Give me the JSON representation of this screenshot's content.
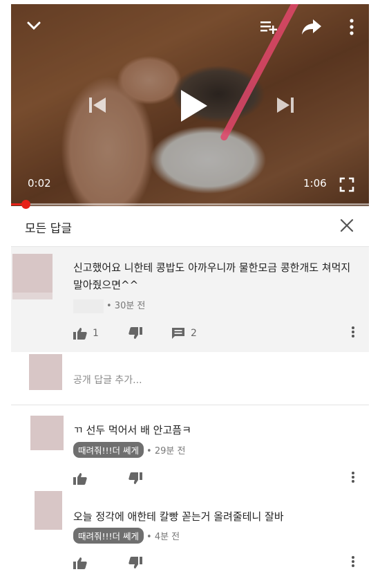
{
  "player": {
    "current_time": "0:02",
    "duration": "1:06",
    "progress": 0.04,
    "icons": [
      "chevron-down-icon",
      "add-to-queue-icon",
      "share-icon",
      "more-vert-icon",
      "skip-previous-icon",
      "play-icon",
      "skip-next-icon",
      "fullscreen-icon"
    ]
  },
  "replies_panel": {
    "title": "모든 답글",
    "close_icon": "close-icon",
    "main_comment": {
      "text": "신고했어요 니한테 콩밥도 아까우니까 물한모금 콩한개도 쳐먹지말아줬으면^^",
      "time": "• 30분 전",
      "likes": "1",
      "replies": "2"
    },
    "add_reply_placeholder": "공개 답글 추가...",
    "replies": [
      {
        "text": "ㄲ 선두 먹어서 배 안고픔ㅋ",
        "author": "때려줘!!!더 쎄게",
        "time": "• 29분 전"
      },
      {
        "text": "오늘 정각에 애한테 칼빵 꼳는거 올려줄테니 잘바",
        "author": "때려줘!!!더 쎄게",
        "time": "• 4분 전"
      }
    ]
  },
  "colors": {
    "accent": "#e62117",
    "chip_bg": "#6f6f6f",
    "avatar": "#d8c6c6",
    "comment_bg": "#f3f3f3"
  }
}
